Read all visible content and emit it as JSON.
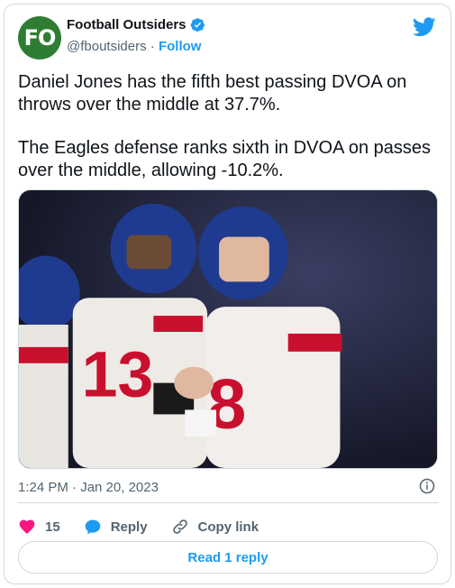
{
  "author": {
    "avatar_text": "FO",
    "name": "Football Outsiders",
    "handle": "@fboutsiders",
    "separator": "·",
    "follow_label": "Follow"
  },
  "tweet": {
    "paragraphs": [
      "Daniel Jones has the fifth best passing DVOA on throws over the middle at 37.7%.",
      "The Eagles defense ranks sixth in DVOA on passes over the middle, allowing -10.2%."
    ],
    "timestamp": "1:24 PM · Jan 20, 2023"
  },
  "actions": {
    "like_count": "15",
    "reply_label": "Reply",
    "copy_link_label": "Copy link",
    "read_replies_label": "Read 1 reply"
  },
  "colors": {
    "brand": "#1d9bf0",
    "like": "#f91880",
    "avatar_bg": "#2e7d32",
    "text": "#0f1419",
    "muted": "#536471"
  },
  "icons": [
    "verified-badge-icon",
    "twitter-bird-icon",
    "info-icon",
    "heart-icon",
    "reply-bubble-icon",
    "link-icon"
  ]
}
